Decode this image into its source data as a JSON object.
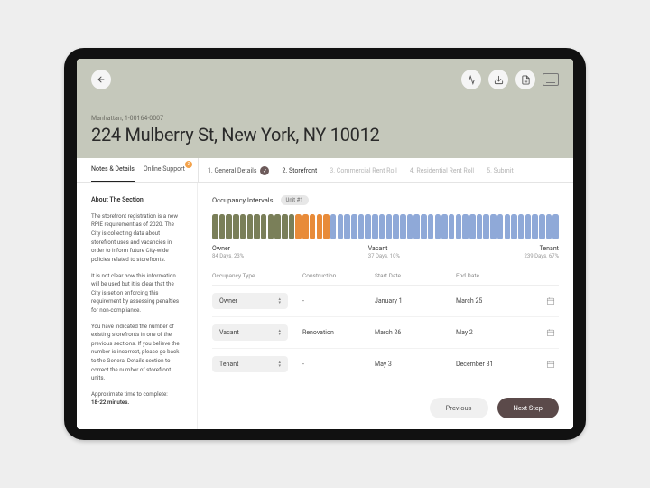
{
  "parcel_id": "Manhattan, 1-00164-0007",
  "address": "224 Mulberry St, New York, NY 10012",
  "left_tabs": {
    "notes": "Notes & Details",
    "support": "Online Support",
    "support_badge": "2"
  },
  "steps": {
    "s1": "1. General Details",
    "s2": "2. Storefront",
    "s3": "3. Commercial Rent Roll",
    "s4": "4. Residential Rent Roll",
    "s5": "5. Submit"
  },
  "side": {
    "heading": "About The Section",
    "p1": "The storefront registration is a new RPIE requirement as of 2020. The City is collecting data about storefront uses and vacancies in order to inform future City-wide policies related to storefronts.",
    "p2": "It is not clear how this information will be used but it is clear that the City is set on enforcing this requirement by assessing penalties for non-compliance.",
    "p3": "You have indicated the number of existing storefronts in one of the previous sections. If you believe the number is incorrect, please go back to the General Details section to correct the number of storefront units.",
    "p4a": "Approximate time to complete:",
    "p4b": "18-22 minutes."
  },
  "intervals": {
    "title": "Occupancy Intervals",
    "unit_pill": "Unit #1",
    "legend": {
      "owner": {
        "name": "Owner",
        "sub": "84 Days, 23%"
      },
      "vacant": {
        "name": "Vacant",
        "sub": "37 Days, 10%"
      },
      "tenant": {
        "name": "Tenant",
        "sub": "239 Days, 67%"
      }
    },
    "bar_counts": {
      "owner": 12,
      "vacant": 5,
      "tenant": 33
    }
  },
  "table": {
    "head": {
      "c1": "Occupancy Type",
      "c2": "Construction",
      "c3": "Start Date",
      "c4": "End Date"
    },
    "rows": [
      {
        "type": "Owner",
        "construction": "-",
        "start": "January 1",
        "end": "March 25"
      },
      {
        "type": "Vacant",
        "construction": "Renovation",
        "start": "March 26",
        "end": "May 2"
      },
      {
        "type": "Tenant",
        "construction": "-",
        "start": "May 3",
        "end": "December 31"
      }
    ]
  },
  "footer": {
    "prev": "Previous",
    "next": "Next Step"
  }
}
